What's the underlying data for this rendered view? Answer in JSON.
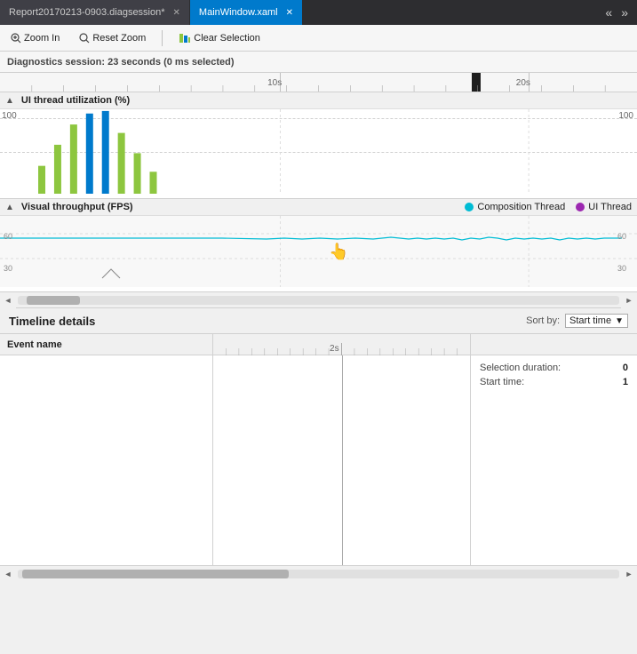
{
  "tabbar": {
    "tabs": [
      {
        "label": "Report20170213-0903.diagsession*",
        "active": false,
        "id": "diag-tab"
      },
      {
        "label": "MainWindow.xaml",
        "active": true,
        "id": "xaml-tab"
      }
    ],
    "nav_left": "«",
    "nav_right": "»"
  },
  "toolbar": {
    "zoom_in_label": "Zoom In",
    "reset_zoom_label": "Reset Zoom",
    "clear_selection_label": "Clear Selection"
  },
  "session": {
    "info": "Diagnostics session: 23 seconds (0 ms selected)"
  },
  "ruler": {
    "ticks": [
      {
        "label": "10s",
        "pos_pct": 44
      },
      {
        "label": "20s",
        "pos_pct": 83
      }
    ],
    "highlight_pos_pct": 75,
    "highlight_width": 10
  },
  "ui_thread_chart": {
    "title": "UI thread utilization (%)",
    "label_top_left": "100",
    "label_top_right": "100",
    "bars": [
      {
        "height_pct": 30,
        "color": "#8dc63f"
      },
      {
        "height_pct": 55,
        "color": "#8dc63f"
      },
      {
        "height_pct": 80,
        "color": "#8dc63f"
      },
      {
        "height_pct": 95,
        "color": "#007acc"
      },
      {
        "height_pct": 100,
        "color": "#007acc"
      },
      {
        "height_pct": 70,
        "color": "#8dc63f"
      },
      {
        "height_pct": 45,
        "color": "#8dc63f"
      },
      {
        "height_pct": 20,
        "color": "#8dc63f"
      }
    ]
  },
  "fps_chart": {
    "title": "Visual throughput (FPS)",
    "label_60_left": "60",
    "label_60_right": "60",
    "label_30_left": "30",
    "label_30_right": "30",
    "legend": [
      {
        "label": "Composition Thread",
        "color": "#00bcd4"
      },
      {
        "label": "UI Thread",
        "color": "#9c27b0"
      }
    ]
  },
  "timeline_details": {
    "title": "Timeline details",
    "sort_by_label": "Sort by:",
    "sort_option": "Start time",
    "dropdown_arrow": "▼"
  },
  "table": {
    "event_name_header": "Event name",
    "ruler2_ticks": [
      {
        "label": "2s",
        "pos_pct": 50
      }
    ],
    "detail_rows": [
      {
        "label": "Selection duration:",
        "value": "0"
      },
      {
        "label": "Start time:",
        "value": "1"
      }
    ]
  },
  "bottom_scrollbar": {
    "left_arrow": "◄",
    "right_arrow": "►"
  },
  "icons": {
    "zoom_in": "🔍",
    "zoom_out": "🔍",
    "reset_zoom": "🔍",
    "clear_selection": "📊",
    "collapse_arrow": "▲",
    "cursor_hand": "👆"
  }
}
